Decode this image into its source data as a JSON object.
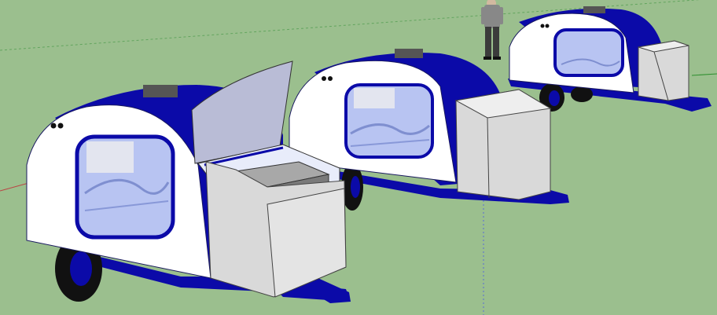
{
  "scene": {
    "title": "",
    "description_hidden": ""
  },
  "colors": {
    "ground": "#9bbf8e",
    "trailer_shell": "#ffffff",
    "trailer_blue": "#0b0aa8",
    "window_frame": "#0b0aa8",
    "window_glass": "#b8c4f2",
    "box_grey": "#d9d9d9",
    "tire": "#111111",
    "axis_green": "#2f8f2f",
    "axis_red": "#b44",
    "axis_blue": "#4a5dd0"
  },
  "trailers": [
    {
      "name": "front-trailer"
    },
    {
      "name": "middle-trailer"
    },
    {
      "name": "back-trailer"
    }
  ],
  "person": {
    "name": "standing-person"
  }
}
